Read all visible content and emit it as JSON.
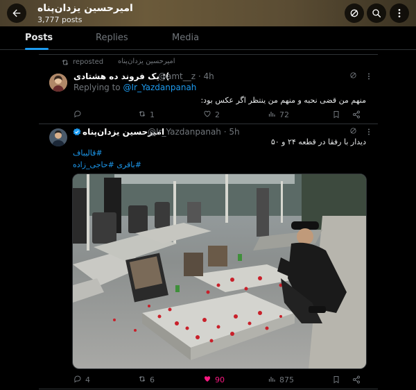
{
  "header": {
    "profile_name": "امیرحسین یزدان‌پناه",
    "posts_count": "3,777 posts"
  },
  "tabs": [
    "Posts",
    "Replies",
    "Media"
  ],
  "reposted": {
    "reposter": "امیرحسین یزدان‌پناه",
    "label": "reposted"
  },
  "tweet1": {
    "display_name": "یک فروند ده هشتادی :(",
    "handle": "@amt__z · 4h",
    "replying_to_label": "Replying to",
    "replying_to_handle": "@Ir_Yazdanpanah",
    "text": "منهم من قضی نحبه و منهم من ینتظر اگر عکس بود:",
    "replies": "",
    "reposts": "1",
    "likes": "2",
    "views": "72"
  },
  "tweet2": {
    "display_name": "امیرحسین یزدان‌پناه",
    "handle": "@Ir_Yazdanpanah · 5h",
    "text": "دیدار با رفقا در قطعه ۲۴ و ۵۰",
    "hashtag1": "#قالیباف",
    "hashtag2": "#باقری #حاجی_زاده",
    "replies": "4",
    "reposts": "6",
    "likes": "90",
    "views": "875",
    "like_color": "#f91880"
  },
  "icons": [
    "back-arrow-icon",
    "grok-icon",
    "search-icon",
    "more-icon",
    "repost-icon",
    "reply-icon",
    "like-icon",
    "views-icon",
    "bookmark-icon",
    "share-icon",
    "verified-badge-icon"
  ],
  "colors": {
    "accent": "#1d9bf0",
    "text": "#e7e9ea",
    "muted": "#71767b",
    "border": "#2f3336",
    "like": "#f91880"
  }
}
